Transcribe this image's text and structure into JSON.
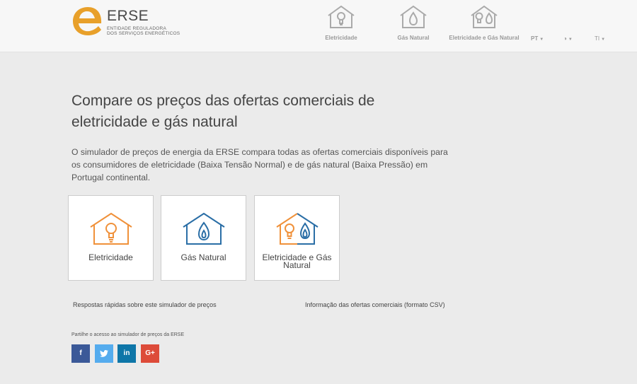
{
  "header": {
    "logo": {
      "name": "ERSE",
      "sub_line1": "ENTIDADE REGULADORA",
      "sub_line2": "DOS SERVIÇOS ENERGÉTICOS"
    },
    "nav": [
      {
        "label": "Eletricidade",
        "icon": "house-bulb-icon"
      },
      {
        "label": "Gás Natural",
        "icon": "house-flame-icon"
      },
      {
        "label": "Eletricidade e Gás Natural",
        "icon": "house-bulb-flame-icon"
      }
    ],
    "language": "PT",
    "contrast_icon": "◑",
    "text_size": "TI"
  },
  "main": {
    "title": "Compare os preços das ofertas comerciais de eletricidade e gás natural",
    "description": "O simulador de preços de energia da ERSE compara todas as ofertas comerciais disponíveis para os consumidores de eletricidade (Baixa Tensão Normal) e de gás natural (Baixa Pressão) em Portugal continental.",
    "cards": [
      {
        "label": "Eletricidade",
        "icon": "house-bulb-icon"
      },
      {
        "label": "Gás Natural",
        "icon": "house-flame-icon"
      },
      {
        "label": "Eletricidade e Gás Natural",
        "icon": "house-bulb-flame-icon"
      }
    ],
    "links": {
      "faq": "Respostas rápidas sobre este simulador de preços",
      "csv": "Informação das ofertas comerciais (formato CSV)"
    },
    "share": {
      "label": "Partilhe o acesso ao simulador de preços da ERSE",
      "buttons": [
        {
          "network": "facebook",
          "glyph": "f",
          "color": "#3b5998"
        },
        {
          "network": "twitter",
          "glyph": "t",
          "color": "#55acee"
        },
        {
          "network": "linkedin",
          "glyph": "in",
          "color": "#0e76a8"
        },
        {
          "network": "google-plus",
          "glyph": "G+",
          "color": "#dd4b39"
        }
      ]
    }
  },
  "colors": {
    "orange": "#f0913a",
    "blue": "#2a6ea6",
    "logo_orange": "#e8a02a"
  }
}
